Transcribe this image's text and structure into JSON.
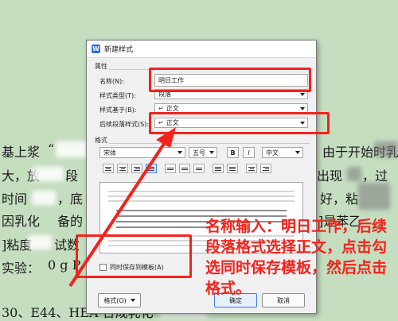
{
  "document": {
    "line1_left": "基上浆",
    "line1_mid": "“",
    "line1_right": "由于开始时乳",
    "line2_left": "大，放",
    "line2_mid": "段",
    "line2_right": "出现",
    "line2_right2": "，过",
    "line3_left": "时间",
    "line3_mid": "，底",
    "line3_right": "好，粘",
    "line4_left": "因乳化",
    "line4_mid": "备的",
    "line4_right": "]是苯乙",
    "line5_left": "]粘度",
    "line5_mid": "试数",
    "line6_left": "实验：",
    "line6_mid": "0 g P",
    "line7_left": "30、E44、HEA 合成乳化"
  },
  "dialog": {
    "title": "新建样式",
    "app_logo_letter": "W",
    "properties_group": "属性",
    "name_label": "名称(N):",
    "name_value": "明日工作",
    "style_type_label": "样式类型(T):",
    "style_type_value": "段落",
    "based_on_label": "样式基于(B):",
    "based_on_value": "正文",
    "next_para_label": "后续段落样式(S):",
    "next_para_value": "正文",
    "format_group": "格式",
    "font_value": "宋体",
    "size_value": "五号",
    "bold_label": "B",
    "italic_label": "I",
    "lang_value": "中文",
    "save_template_label": "同时保存到模板(A)",
    "format_button": "格式(O)",
    "ok_button": "确定",
    "cancel_button": "取消"
  },
  "annotation": {
    "text": "名称输入：明日工作，后续段落格式选择正文，点击勾选同时保存模板，然后点击格式。",
    "color": "#f2231c"
  }
}
